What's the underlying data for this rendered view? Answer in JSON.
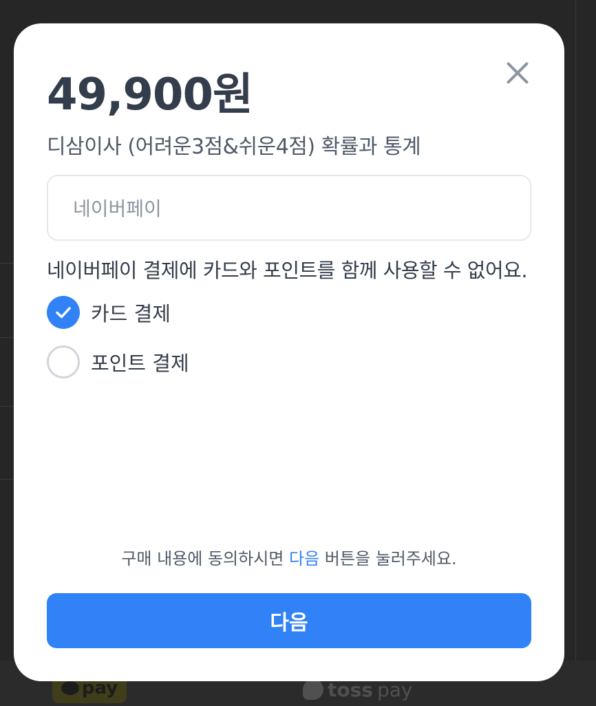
{
  "background": {
    "kakaopay_label": "pay",
    "tosspay_label": {
      "toss": "toss",
      "pay": "pay"
    }
  },
  "modal": {
    "price": "49,900원",
    "product_name": "디삼이사 (어려운3점&쉬운4점) 확률과 통계",
    "payment_method": "네이버페이",
    "notice": "네이버페이 결제에 카드와 포인트를 함께 사용할 수 없어요.",
    "options": [
      {
        "label": "카드 결제",
        "checked": true
      },
      {
        "label": "포인트 결제",
        "checked": false
      }
    ],
    "agreement": {
      "before": "구매 내용에 동의하시면 ",
      "highlight": "다음",
      "after": " 버튼을 눌러주세요."
    },
    "next_button": "다음"
  },
  "colors": {
    "accent": "#3182f6",
    "text_primary": "#333d4b",
    "text_secondary": "#4e5968",
    "placeholder": "#8b95a1",
    "border": "#e5e8eb"
  },
  "icons": {
    "close": "close-icon",
    "check": "check-icon"
  }
}
